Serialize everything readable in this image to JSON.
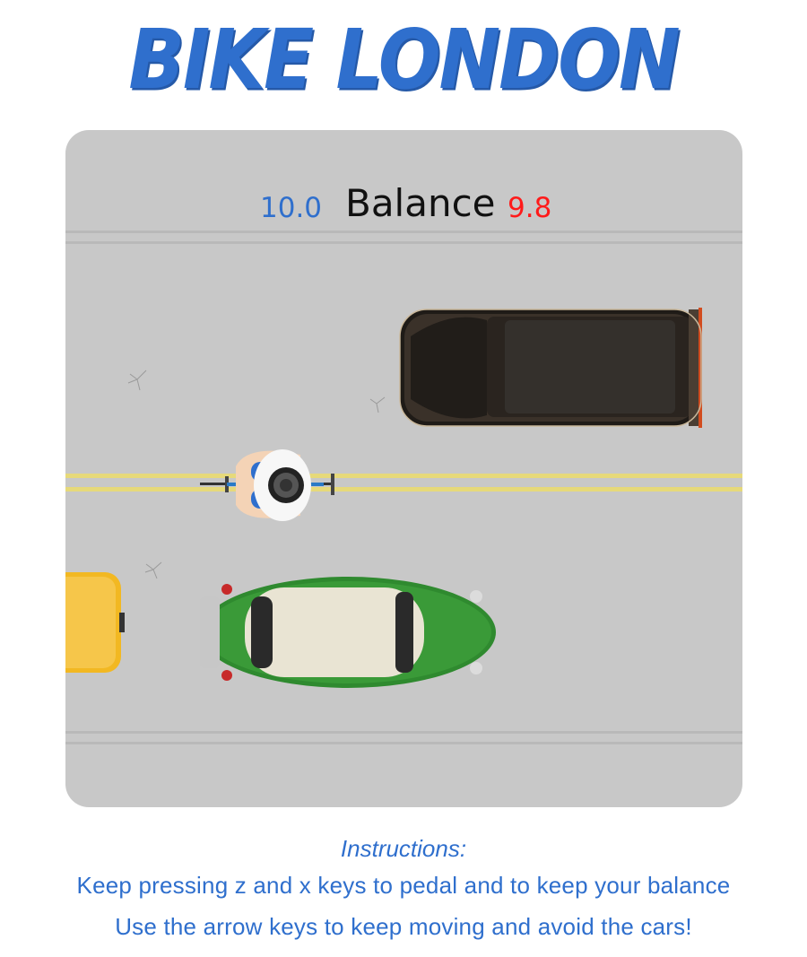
{
  "title": "BIKE LONDON",
  "hud": {
    "left_value": "10.0",
    "label": "Balance",
    "right_value": "9.8",
    "left_color": "#2f6fcd",
    "right_color": "#ff1a1a"
  },
  "game": {
    "road_color": "#c8c8c8",
    "center_line_color": "#e6d97a",
    "vehicles": [
      {
        "name": "black-taxi",
        "color": "#2a2520"
      },
      {
        "name": "green-beetle",
        "color": "#2f8a2f"
      },
      {
        "name": "yellow-car",
        "color": "#f2b822"
      }
    ],
    "player": "cyclist"
  },
  "instructions": {
    "heading": "Instructions:",
    "line1": "Keep pressing z and x keys to pedal and to keep your balance",
    "line2": "Use the arrow keys to keep moving and avoid the cars!"
  },
  "brand_color": "#2f6fcd"
}
